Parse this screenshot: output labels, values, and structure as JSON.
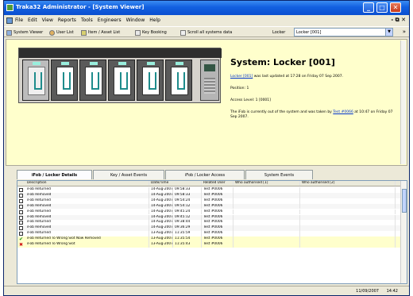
{
  "window": {
    "title": "Traka32 Administrator - [System Viewer]",
    "min": "_",
    "max": "□",
    "close": "✕"
  },
  "menu": {
    "items": [
      "File",
      "Edit",
      "View",
      "Reports",
      "Tools",
      "Engineers",
      "Window",
      "Help"
    ],
    "mdi_controls": "- ⧉ ✕"
  },
  "toolbar": {
    "system_viewer": "System Viewer",
    "user_list": "User List",
    "item_asset_list": "Item / Asset List",
    "key_booking": "Key Booking",
    "scroll_all": "Scroll all systems data",
    "locker_label": "Locker",
    "locker_value": "Locker [001]",
    "more": "»"
  },
  "info": {
    "title": "System: Locker [001]",
    "updated_link": "Locker [001]",
    "updated_text": "was last updated at 17:28 on Friday 07 Sep 2007.",
    "position": "Position: 1",
    "access": "Access Level: 1 [0001]",
    "status_text": "The iFob is currently out of the system and was taken by",
    "user_link": "Test #0066",
    "status_tail": "at 10:47 on Friday 07 Sep 2007."
  },
  "tabs": [
    {
      "label": "iFob / Locker Details"
    },
    {
      "label": "Key / Asset Events"
    },
    {
      "label": "iFob / Locker Access"
    },
    {
      "label": "System Events"
    }
  ],
  "grid": {
    "columns": [
      "Description",
      "Date/Time",
      "Related User",
      "Who authorised [1]",
      "Who authorised [2]"
    ],
    "rows": [
      {
        "desc": "iFob Returned",
        "date": "14-Aug-2007",
        "time": "09:58:33",
        "user": "Test #0006",
        "icon": "doc"
      },
      {
        "desc": "iFob Removed",
        "date": "14-Aug-2007",
        "time": "09:58:33",
        "user": "Test #0006",
        "icon": "doc"
      },
      {
        "desc": "iFob Returned",
        "date": "14-Aug-2007",
        "time": "09:54:24",
        "user": "Test #0006",
        "icon": "doc"
      },
      {
        "desc": "iFob Removed",
        "date": "14-Aug-2007",
        "time": "09:54:12",
        "user": "Test #0006",
        "icon": "doc"
      },
      {
        "desc": "iFob Returned",
        "date": "14-Aug-2007",
        "time": "09:45:24",
        "user": "Test #0006",
        "icon": "doc"
      },
      {
        "desc": "iFob Removed",
        "date": "14-Aug-2007",
        "time": "09:45:12",
        "user": "Test #0006",
        "icon": "doc"
      },
      {
        "desc": "iFob Returned",
        "date": "14-Aug-2007",
        "time": "09:38:44",
        "user": "Test #0006",
        "icon": "doc"
      },
      {
        "desc": "iFob Removed",
        "date": "14-Aug-2007",
        "time": "09:36:29",
        "user": "Test #0006",
        "icon": "doc"
      },
      {
        "desc": "iFob Returned",
        "date": "13-Aug-2007",
        "time": "11:35:59",
        "user": "Test #0006",
        "icon": "doc"
      },
      {
        "desc": "iFob Returned To Wrong Slot Now Removed",
        "date": "13-Aug-2007",
        "time": "11:35:54",
        "user": "Test #0006",
        "icon": "ok"
      },
      {
        "desc": "iFob Returned To Wrong Slot",
        "date": "13-Aug-2007",
        "time": "11:35:43",
        "user": "Test #0006",
        "icon": "err"
      }
    ]
  },
  "status": {
    "date": "11/09/2007",
    "time": "14:42"
  },
  "colors": {
    "titlebar": "#1260e0",
    "info_panel": "#ffffcc",
    "link": "#0033cc",
    "key_accent": "#1e8c8c"
  }
}
